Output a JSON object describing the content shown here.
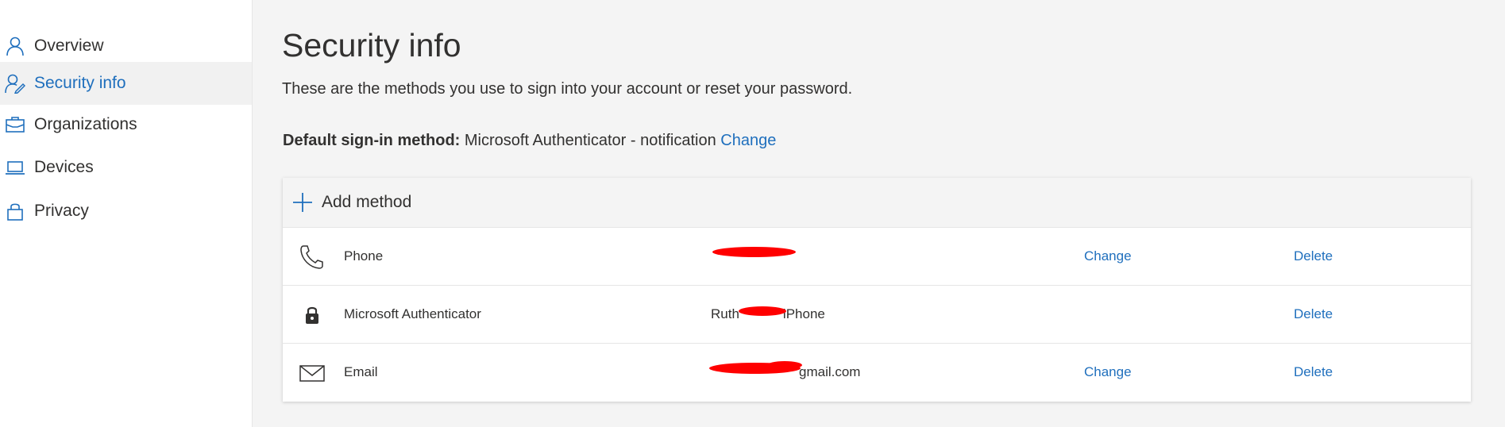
{
  "sidebar": {
    "items": [
      {
        "label": "Overview",
        "icon": "person-icon"
      },
      {
        "label": "Security info",
        "icon": "person-key-icon",
        "active": true
      },
      {
        "label": "Organizations",
        "icon": "briefcase-icon"
      },
      {
        "label": "Devices",
        "icon": "laptop-icon"
      },
      {
        "label": "Privacy",
        "icon": "lock-icon"
      }
    ]
  },
  "main": {
    "title": "Security info",
    "subtitle": "These are the methods you use to sign into your account or reset your password.",
    "default_method": {
      "label": "Default sign-in method:",
      "value": "Microsoft Authenticator - notification",
      "change_label": "Change"
    },
    "add_method_label": "Add method",
    "methods": [
      {
        "name": "Phone",
        "detail": "",
        "change_label": "Change",
        "delete_label": "Delete",
        "icon": "phone-icon"
      },
      {
        "name": "Microsoft Authenticator",
        "detail_prefix": "Ruth",
        "detail_suffix": "iPhone",
        "change_label": "",
        "delete_label": "Delete",
        "icon": "authenticator-lock-icon"
      },
      {
        "name": "Email",
        "detail": "gmail.com",
        "change_label": "Change",
        "delete_label": "Delete",
        "icon": "mail-icon"
      }
    ]
  },
  "colors": {
    "accent": "#1f6fbd",
    "redaction": "#ff0000",
    "page_bg": "#f4f4f4"
  }
}
